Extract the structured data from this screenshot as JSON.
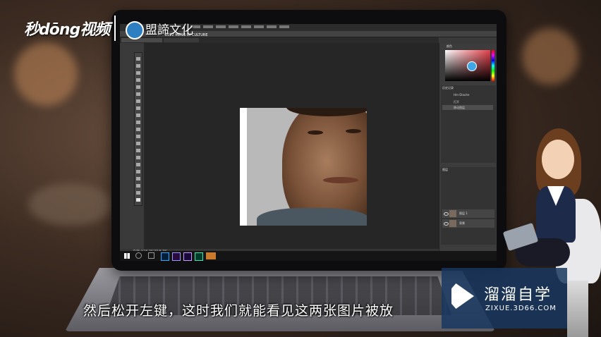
{
  "brand": {
    "logo_text": "秒dōng视频",
    "publisher": "盟諦文化",
    "publisher_sub": "2022 MENG DI CULTURE"
  },
  "photoshop": {
    "status_text": "文档:318.3K/318.3K",
    "panels": {
      "color_tab": "颜色",
      "history_tab": "历史记录",
      "layers_tab": "图层"
    },
    "history": [
      "Hm-Diaohe",
      "打开",
      "移动图层"
    ],
    "layers": [
      "图层 1",
      "背景"
    ],
    "picker_color": "#3fa7e8"
  },
  "subtitle": "然后松开左键，这时我们就能看见这两张图片被放",
  "watermark": {
    "title": "溜溜自学",
    "url": "ZIXUE.3D66.COM"
  }
}
